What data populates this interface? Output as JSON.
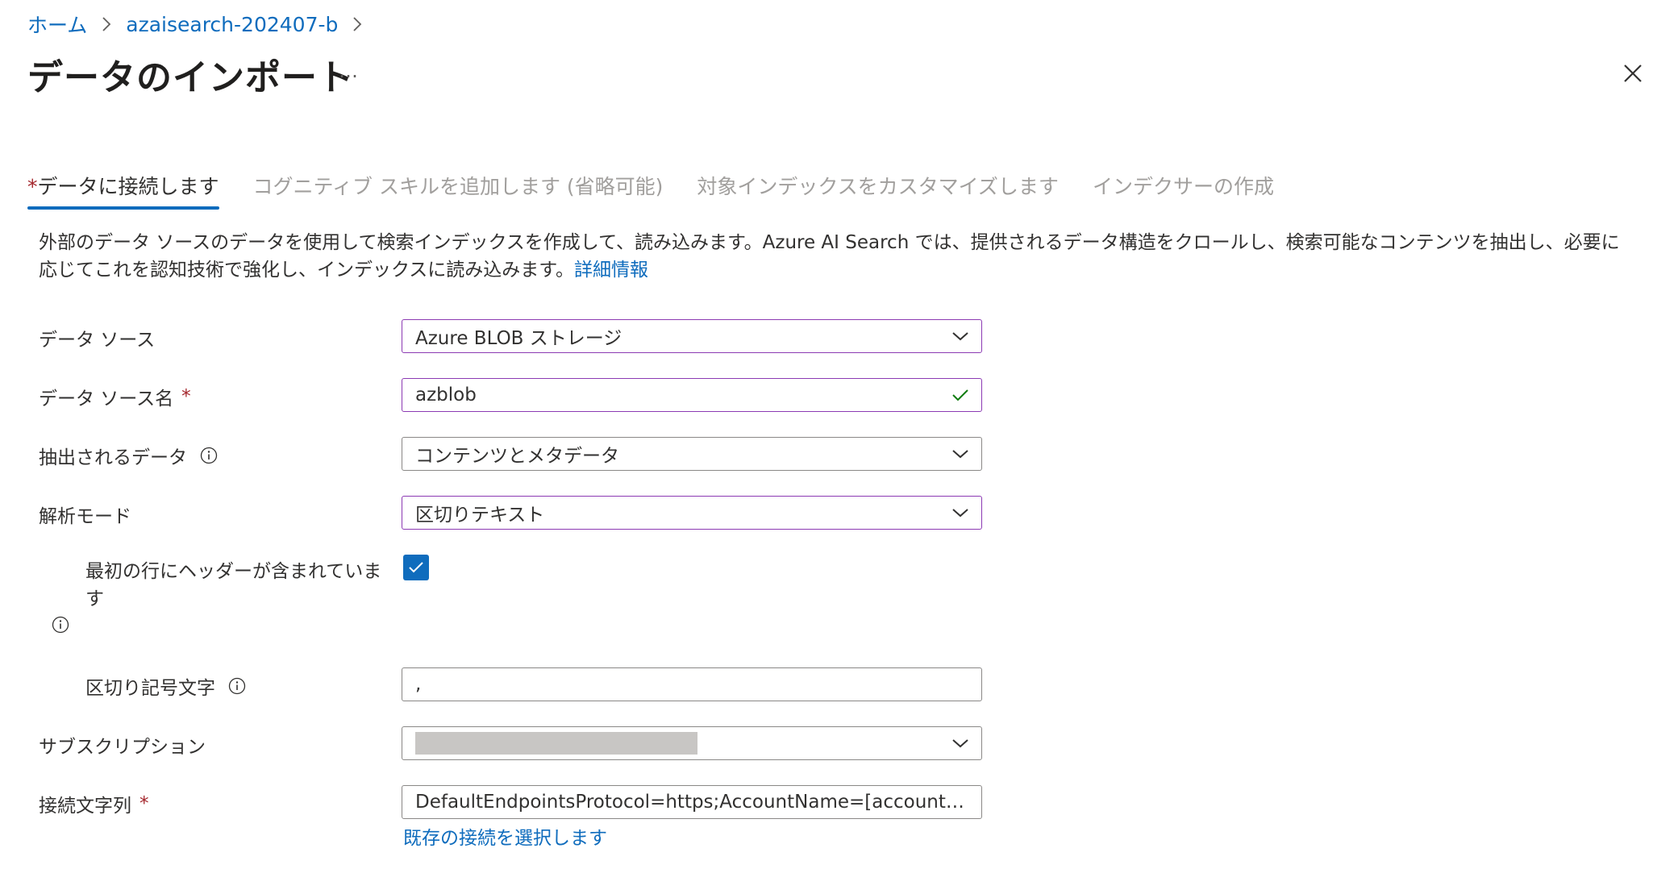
{
  "breadcrumb": {
    "home": "ホーム",
    "resource": "azaisearch-202407-b"
  },
  "header": {
    "title": "データのインポート",
    "more": "…"
  },
  "tabs": [
    {
      "label": "データに接続します",
      "active": true,
      "required": true
    },
    {
      "label": "コグニティブ スキルを追加します (省略可能)",
      "active": false
    },
    {
      "label": "対象インデックスをカスタマイズします",
      "active": false
    },
    {
      "label": "インデクサーの作成",
      "active": false
    }
  ],
  "tab_required_mark": "*",
  "description": {
    "text": "外部のデータ ソースのデータを使用して検索インデックスを作成して、読み込みます。Azure AI Search では、提供されるデータ構造をクロールし、検索可能なコンテンツを抽出し、必要に応じてこれを認知技術で強化し、インデックスに読み込みます。",
    "link": "詳細情報"
  },
  "form": {
    "required_mark": "*",
    "data_source": {
      "label": "データ ソース",
      "value": "Azure BLOB ストレージ"
    },
    "data_source_name": {
      "label": "データ ソース名",
      "value": "azblob"
    },
    "extracted_data": {
      "label": "抽出されるデータ",
      "value": "コンテンツとメタデータ"
    },
    "parsing_mode": {
      "label": "解析モード",
      "value": "区切りテキスト"
    },
    "first_line_header": {
      "label_line1": "最初の行にヘッダーが含まれていま",
      "label_line2": "す",
      "checked": true
    },
    "delimiter": {
      "label": "区切り記号文字",
      "value": ","
    },
    "subscription": {
      "label": "サブスクリプション"
    },
    "connection_string": {
      "label": "接続文字列",
      "value": "DefaultEndpointsProtocol=https;AccountName=[accountN…",
      "link": "既存の接続を選択します"
    }
  },
  "colors": {
    "accent": "#0f6cbd",
    "focus_border": "#8c3ab3",
    "required": "#a4262c",
    "valid_check": "#107c10"
  }
}
